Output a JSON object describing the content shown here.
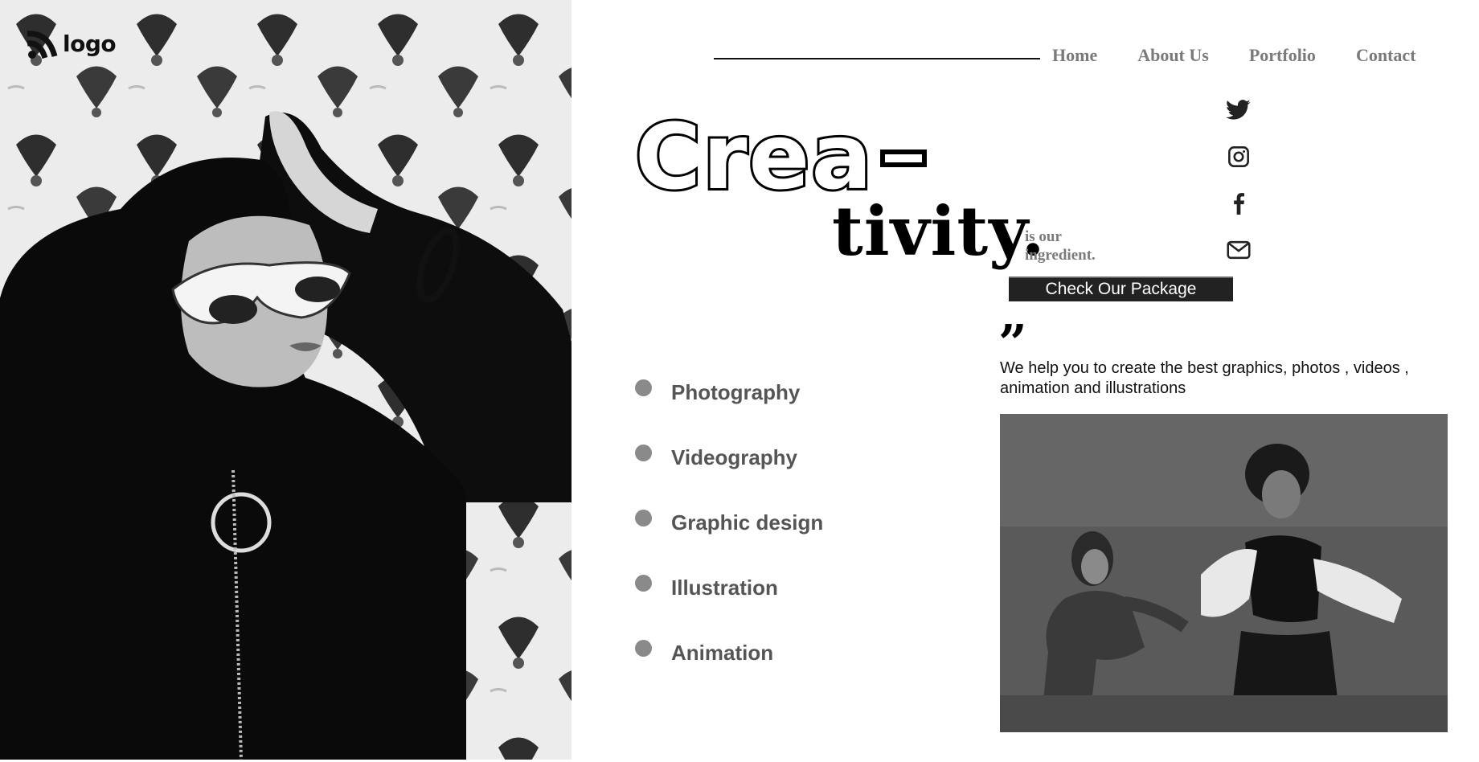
{
  "brand": {
    "logo_text": "logo",
    "logo_icon": "rss-style-logo-icon"
  },
  "nav": {
    "items": [
      {
        "label": "Home"
      },
      {
        "label": "About Us"
      },
      {
        "label": "Portfolio"
      },
      {
        "label": "Contact"
      }
    ]
  },
  "social": [
    {
      "icon": "twitter-icon"
    },
    {
      "icon": "instagram-icon"
    },
    {
      "icon": "facebook-icon"
    },
    {
      "icon": "mail-icon"
    }
  ],
  "hero": {
    "title_part1": "Crea",
    "title_part2": "tivity.",
    "tagline": "is our ingredient.",
    "cta_label": "Check Our Package"
  },
  "services": [
    {
      "label": "Photography"
    },
    {
      "label": "Videography"
    },
    {
      "label": "Graphic design"
    },
    {
      "label": "Illustration"
    },
    {
      "label": "Animation"
    }
  ],
  "quote": {
    "mark": "”",
    "text": "We help you to create the best graphics, photos , videos , animation and illustrations"
  },
  "colors": {
    "accent": "#000000",
    "muted_text": "#7a7a7a",
    "button_bg": "#222222",
    "bullet": "#8a8a8a"
  }
}
